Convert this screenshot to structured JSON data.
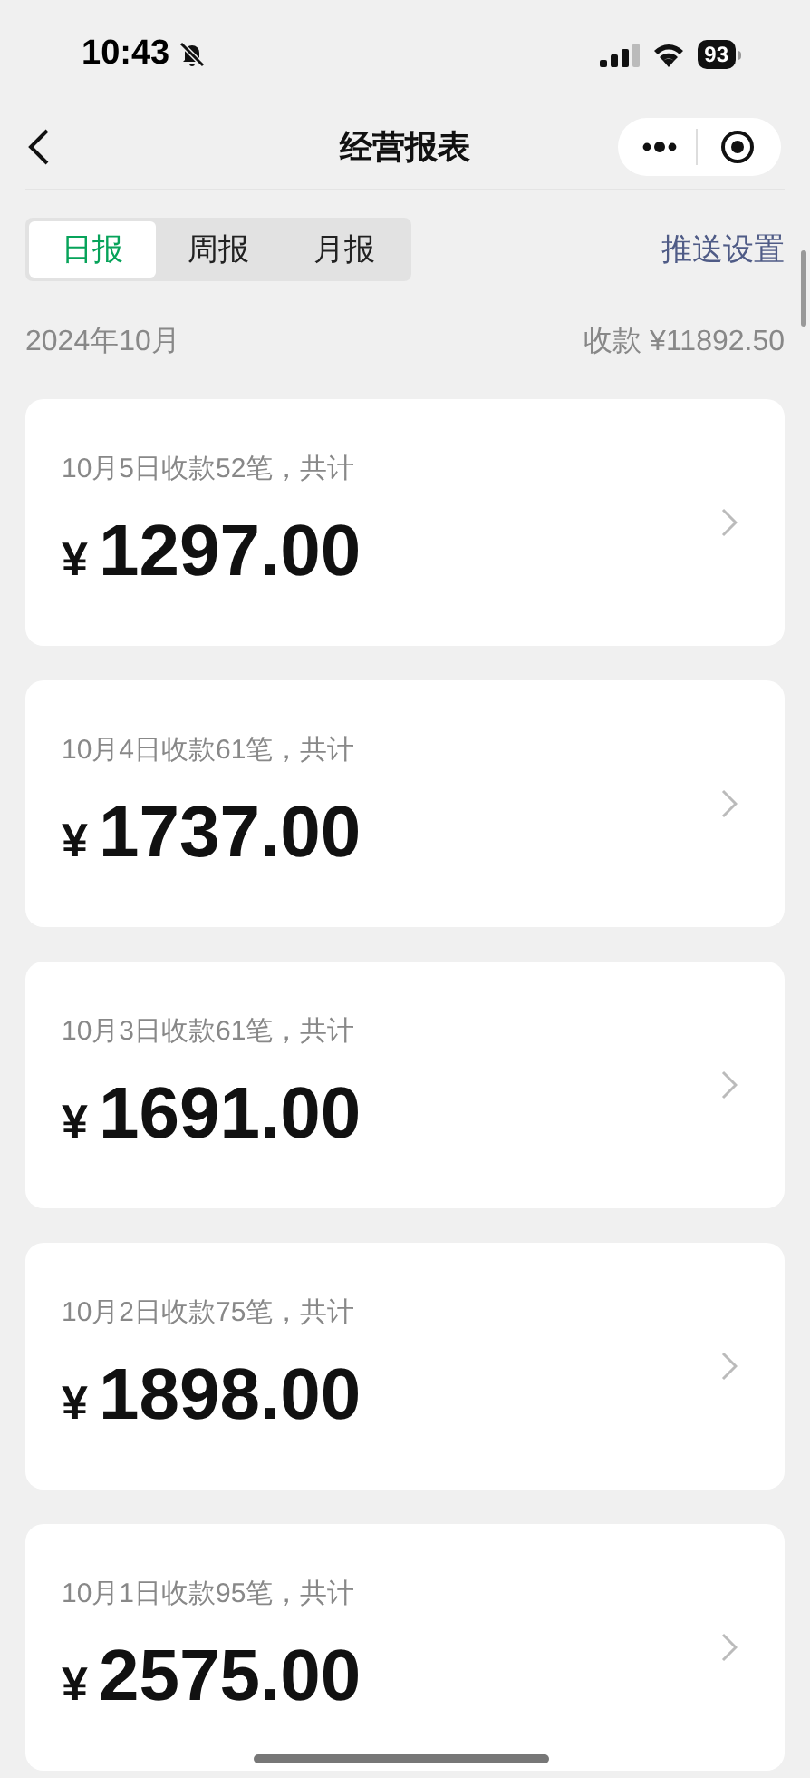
{
  "status_bar": {
    "time": "10:43",
    "battery": "93"
  },
  "nav": {
    "title": "经营报表"
  },
  "tabs": [
    {
      "label": "日报",
      "selected": true
    },
    {
      "label": "周报",
      "selected": false
    },
    {
      "label": "月报",
      "selected": false
    }
  ],
  "push_settings": "推送设置",
  "summary": {
    "month": "2024年10月",
    "total": "收款 ¥11892.50"
  },
  "days": [
    {
      "caption": "10月5日收款52笔，共计",
      "currency": "¥",
      "amount": "1297.00"
    },
    {
      "caption": "10月4日收款61笔，共计",
      "currency": "¥",
      "amount": "1737.00"
    },
    {
      "caption": "10月3日收款61笔，共计",
      "currency": "¥",
      "amount": "1691.00"
    },
    {
      "caption": "10月2日收款75笔，共计",
      "currency": "¥",
      "amount": "1898.00"
    },
    {
      "caption": "10月1日收款95笔，共计",
      "currency": "¥",
      "amount": "2575.00"
    }
  ]
}
